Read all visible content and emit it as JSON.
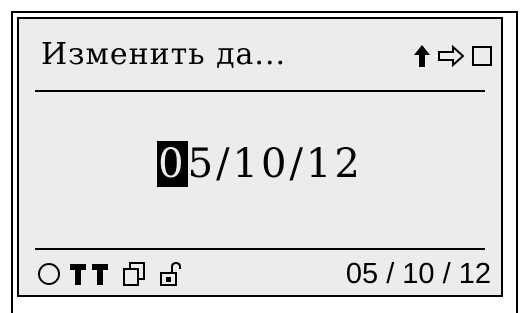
{
  "screen": {
    "title": "Изменить да...",
    "nav_icons": [
      "up-arrow-icon",
      "right-arrow-icon",
      "square-icon"
    ]
  },
  "editor": {
    "cursor_digit": "0",
    "rest": "5/10/12"
  },
  "status_bar": {
    "icons": [
      "circle-icon",
      "antenna-icon",
      "antenna-icon",
      "copy-icon",
      "unlock-icon"
    ],
    "date": "05 / 10 / 12"
  },
  "colors": {
    "screen_bg": "#ececec",
    "foreground": "#000000"
  }
}
